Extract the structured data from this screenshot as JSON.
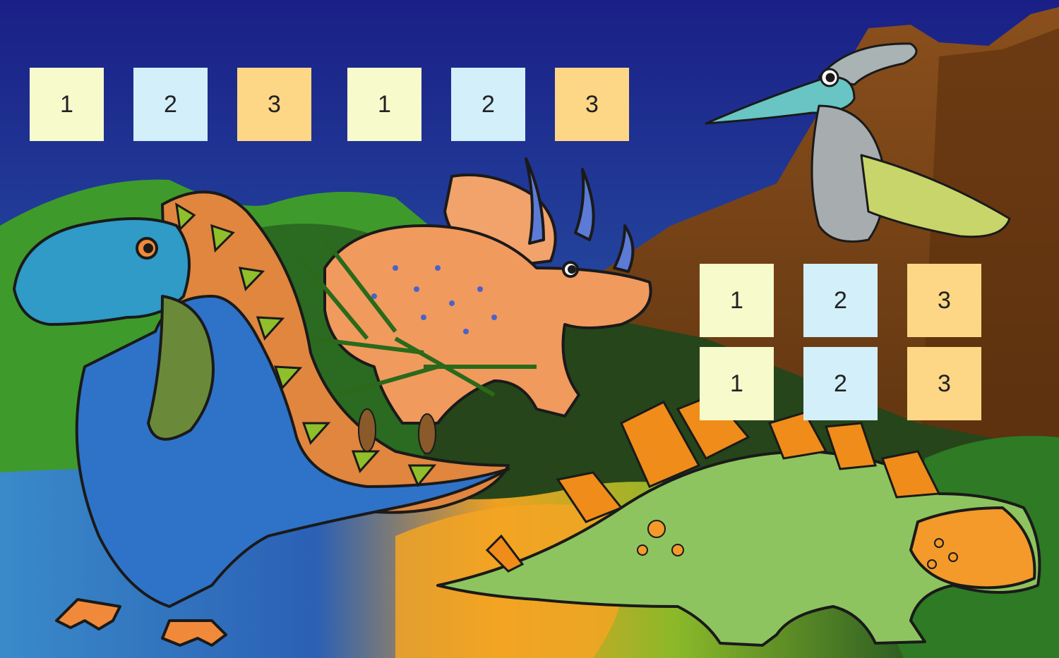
{
  "palette": {
    "sky_top": "#1a1f86",
    "sky_bottom": "#2d5ab3",
    "grass": "#3e9b2a",
    "volcano": "#6e3c12",
    "tile_1": "#f7fbcc",
    "tile_2": "#d2effa",
    "tile_3": "#fdd785"
  },
  "top_row": {
    "tiles": [
      {
        "label": "1"
      },
      {
        "label": "2"
      },
      {
        "label": "3"
      },
      {
        "label": "1"
      },
      {
        "label": "2"
      },
      {
        "label": "3"
      }
    ]
  },
  "side_grid": {
    "row1": [
      {
        "label": "1"
      },
      {
        "label": "2"
      },
      {
        "label": "3"
      }
    ],
    "row2": [
      {
        "label": "1"
      },
      {
        "label": "2"
      },
      {
        "label": "3"
      }
    ]
  },
  "characters": [
    "blue-spinosaurus",
    "orange-triceratops",
    "pteranodon",
    "green-stegosaurus"
  ]
}
